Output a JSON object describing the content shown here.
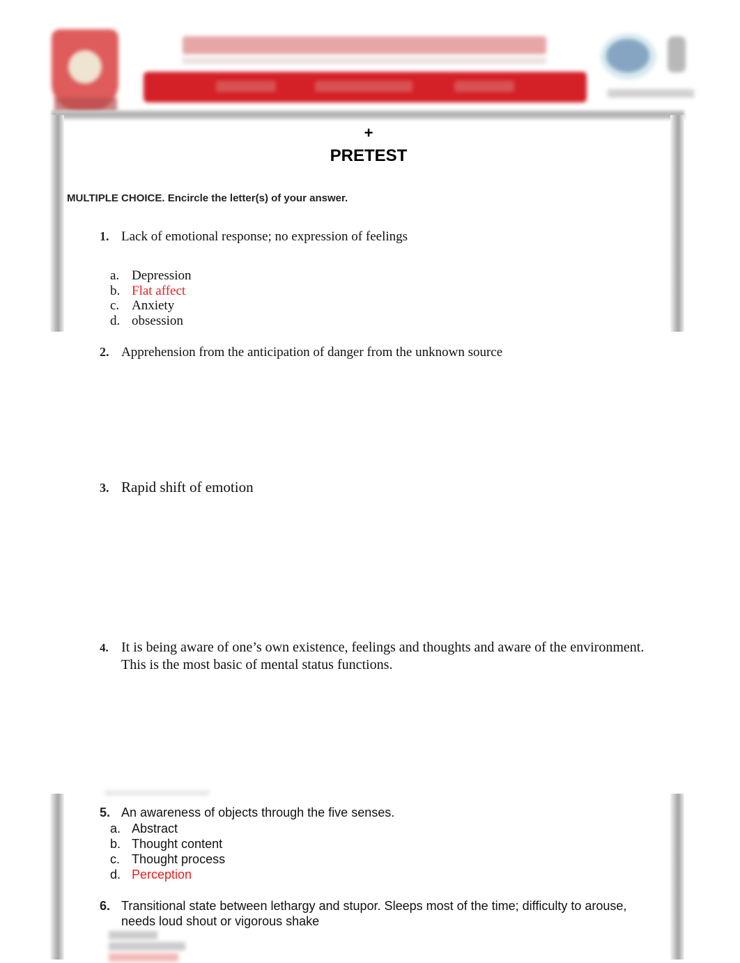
{
  "header": {
    "blurred": true,
    "banner_color": "#d42027"
  },
  "page": {
    "plus_mark": "+",
    "title": "PRETEST",
    "instruction": "MULTIPLE CHOICE.  Encircle the letter(s) of your answer."
  },
  "answer_color": "#ee1c1c",
  "questions": [
    {
      "number": "1.",
      "text": "Lack of emotional response; no expression of feelings",
      "options": [
        {
          "letter": "a.",
          "text": "Depression",
          "highlighted": false
        },
        {
          "letter": "b.",
          "text": "Flat affect",
          "highlighted": true
        },
        {
          "letter": "c.",
          "text": "Anxiety",
          "highlighted": false
        },
        {
          "letter": "d.",
          "text": "obsession",
          "highlighted": false
        }
      ]
    },
    {
      "number": "2.",
      "text": "Apprehension from the anticipation of danger from the unknown source",
      "options": []
    },
    {
      "number": "3.",
      "text": "Rapid shift of emotion",
      "options": []
    },
    {
      "number": "4.",
      "text": "It is being aware of one’s own existence, feelings and thoughts and aware of the environment.",
      "text_line2": "This is the most basic of mental status functions.",
      "options": []
    },
    {
      "number": "5.",
      "text": "An awareness of objects through the five senses.",
      "options": [
        {
          "letter": "a.",
          "text": "Abstract",
          "highlighted": false
        },
        {
          "letter": "b.",
          "text": "Thought content",
          "highlighted": false
        },
        {
          "letter": "c.",
          "text": "Thought process",
          "highlighted": false
        },
        {
          "letter": "d.",
          "text": "Perception",
          "highlighted": true
        }
      ]
    },
    {
      "number": "6.",
      "text": "Transitional state between lethargy and stupor. Sleeps most of the time; difficulty to arouse,",
      "text_line2": "needs loud shout or vigorous shake",
      "options_blurred": true
    }
  ]
}
